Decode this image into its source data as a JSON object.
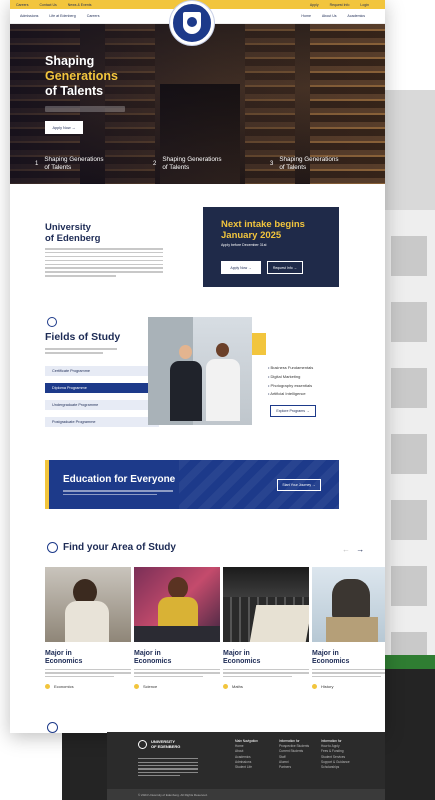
{
  "topbar": {
    "left": [
      "Careers",
      "Contact Us",
      "News & Events"
    ],
    "right": [
      "Apply",
      "Request Info",
      "Login"
    ]
  },
  "nav": {
    "left": [
      "Admissions",
      "Life at Edenberg",
      "Careers"
    ],
    "right": [
      "Home",
      "About Us",
      "Academics"
    ]
  },
  "hero": {
    "line1": "Shaping",
    "line2": "Generations",
    "line3": "of Talents",
    "apply": "Apply Now →",
    "features": [
      {
        "num": "1",
        "text1": "Shaping Generations",
        "text2": "of Talents"
      },
      {
        "num": "2",
        "text1": "Shaping Generations",
        "text2": "of Talents"
      },
      {
        "num": "3",
        "text1": "Shaping Generations",
        "text2": "of Talents"
      }
    ]
  },
  "about": {
    "title1": "University",
    "title2": "of Edenberg"
  },
  "intake": {
    "title1": "Next intake begins",
    "title2": "January 2025",
    "sub": "Apply before December 31st",
    "apply": "Apply Now",
    "request": "Request Info"
  },
  "fields": {
    "title": "Fields of Study",
    "programmes": [
      "Certificate Programme",
      "Diploma Programme",
      "Undergraduate Programme",
      "Postgraduate Programme"
    ],
    "list": [
      "Business Fundamentals",
      "Digital Marketing",
      "Photography essentials",
      "Artificial Intelligence"
    ],
    "explore": "Explore Programs"
  },
  "edu": {
    "title": "Education for Everyone",
    "button": "Start Your Journey"
  },
  "area": {
    "title": "Find your Area of Study",
    "prev": "←",
    "next": "→",
    "cards": [
      {
        "title1": "Major in",
        "title2": "Economics",
        "tag": "Economics"
      },
      {
        "title1": "Major in",
        "title2": "Economics",
        "tag": "Science"
      },
      {
        "title1": "Major in",
        "title2": "Economics",
        "tag": "Maths"
      },
      {
        "title1": "Major in",
        "title2": "Economics",
        "tag": "History"
      }
    ]
  },
  "footer": {
    "uni1": "UNIVERSITY",
    "uni2": "OF EDENBERG",
    "col1": {
      "h": "Main Navigation",
      "items": [
        "Home",
        "About",
        "Academics",
        "Admissions",
        "Student Life"
      ]
    },
    "col2": {
      "h": "Information for",
      "items": [
        "Prospective Students",
        "Current Students",
        "Staff",
        "Alumni",
        "Partners"
      ]
    },
    "col3": {
      "h": "Information for",
      "items": [
        "How to Apply",
        "Fees & Funding",
        "Student Services",
        "Support & Guidance",
        "Scholarships"
      ]
    },
    "copyright": "© 2024 University of Edenberg. All Rights Reserved."
  },
  "colors": {
    "navy": "#1d3a8a",
    "dark_navy": "#1f2a49",
    "gold": "#f2c53d"
  }
}
